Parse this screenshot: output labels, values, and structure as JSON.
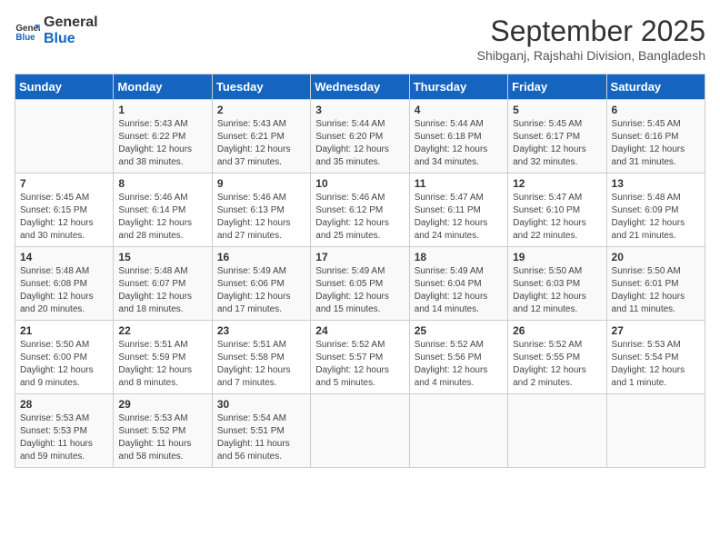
{
  "logo": {
    "line1": "General",
    "line2": "Blue"
  },
  "title": "September 2025",
  "subtitle": "Shibganj, Rajshahi Division, Bangladesh",
  "weekdays": [
    "Sunday",
    "Monday",
    "Tuesday",
    "Wednesday",
    "Thursday",
    "Friday",
    "Saturday"
  ],
  "weeks": [
    [
      {
        "day": null,
        "info": null
      },
      {
        "day": "1",
        "sunrise": "5:43 AM",
        "sunset": "6:22 PM",
        "daylight": "12 hours and 38 minutes."
      },
      {
        "day": "2",
        "sunrise": "5:43 AM",
        "sunset": "6:21 PM",
        "daylight": "12 hours and 37 minutes."
      },
      {
        "day": "3",
        "sunrise": "5:44 AM",
        "sunset": "6:20 PM",
        "daylight": "12 hours and 35 minutes."
      },
      {
        "day": "4",
        "sunrise": "5:44 AM",
        "sunset": "6:18 PM",
        "daylight": "12 hours and 34 minutes."
      },
      {
        "day": "5",
        "sunrise": "5:45 AM",
        "sunset": "6:17 PM",
        "daylight": "12 hours and 32 minutes."
      },
      {
        "day": "6",
        "sunrise": "5:45 AM",
        "sunset": "6:16 PM",
        "daylight": "12 hours and 31 minutes."
      }
    ],
    [
      {
        "day": "7",
        "sunrise": "5:45 AM",
        "sunset": "6:15 PM",
        "daylight": "12 hours and 30 minutes."
      },
      {
        "day": "8",
        "sunrise": "5:46 AM",
        "sunset": "6:14 PM",
        "daylight": "12 hours and 28 minutes."
      },
      {
        "day": "9",
        "sunrise": "5:46 AM",
        "sunset": "6:13 PM",
        "daylight": "12 hours and 27 minutes."
      },
      {
        "day": "10",
        "sunrise": "5:46 AM",
        "sunset": "6:12 PM",
        "daylight": "12 hours and 25 minutes."
      },
      {
        "day": "11",
        "sunrise": "5:47 AM",
        "sunset": "6:11 PM",
        "daylight": "12 hours and 24 minutes."
      },
      {
        "day": "12",
        "sunrise": "5:47 AM",
        "sunset": "6:10 PM",
        "daylight": "12 hours and 22 minutes."
      },
      {
        "day": "13",
        "sunrise": "5:48 AM",
        "sunset": "6:09 PM",
        "daylight": "12 hours and 21 minutes."
      }
    ],
    [
      {
        "day": "14",
        "sunrise": "5:48 AM",
        "sunset": "6:08 PM",
        "daylight": "12 hours and 20 minutes."
      },
      {
        "day": "15",
        "sunrise": "5:48 AM",
        "sunset": "6:07 PM",
        "daylight": "12 hours and 18 minutes."
      },
      {
        "day": "16",
        "sunrise": "5:49 AM",
        "sunset": "6:06 PM",
        "daylight": "12 hours and 17 minutes."
      },
      {
        "day": "17",
        "sunrise": "5:49 AM",
        "sunset": "6:05 PM",
        "daylight": "12 hours and 15 minutes."
      },
      {
        "day": "18",
        "sunrise": "5:49 AM",
        "sunset": "6:04 PM",
        "daylight": "12 hours and 14 minutes."
      },
      {
        "day": "19",
        "sunrise": "5:50 AM",
        "sunset": "6:03 PM",
        "daylight": "12 hours and 12 minutes."
      },
      {
        "day": "20",
        "sunrise": "5:50 AM",
        "sunset": "6:01 PM",
        "daylight": "12 hours and 11 minutes."
      }
    ],
    [
      {
        "day": "21",
        "sunrise": "5:50 AM",
        "sunset": "6:00 PM",
        "daylight": "12 hours and 9 minutes."
      },
      {
        "day": "22",
        "sunrise": "5:51 AM",
        "sunset": "5:59 PM",
        "daylight": "12 hours and 8 minutes."
      },
      {
        "day": "23",
        "sunrise": "5:51 AM",
        "sunset": "5:58 PM",
        "daylight": "12 hours and 7 minutes."
      },
      {
        "day": "24",
        "sunrise": "5:52 AM",
        "sunset": "5:57 PM",
        "daylight": "12 hours and 5 minutes."
      },
      {
        "day": "25",
        "sunrise": "5:52 AM",
        "sunset": "5:56 PM",
        "daylight": "12 hours and 4 minutes."
      },
      {
        "day": "26",
        "sunrise": "5:52 AM",
        "sunset": "5:55 PM",
        "daylight": "12 hours and 2 minutes."
      },
      {
        "day": "27",
        "sunrise": "5:53 AM",
        "sunset": "5:54 PM",
        "daylight": "12 hours and 1 minute."
      }
    ],
    [
      {
        "day": "28",
        "sunrise": "5:53 AM",
        "sunset": "5:53 PM",
        "daylight": "11 hours and 59 minutes."
      },
      {
        "day": "29",
        "sunrise": "5:53 AM",
        "sunset": "5:52 PM",
        "daylight": "11 hours and 58 minutes."
      },
      {
        "day": "30",
        "sunrise": "5:54 AM",
        "sunset": "5:51 PM",
        "daylight": "11 hours and 56 minutes."
      },
      {
        "day": null,
        "info": null
      },
      {
        "day": null,
        "info": null
      },
      {
        "day": null,
        "info": null
      },
      {
        "day": null,
        "info": null
      }
    ]
  ]
}
